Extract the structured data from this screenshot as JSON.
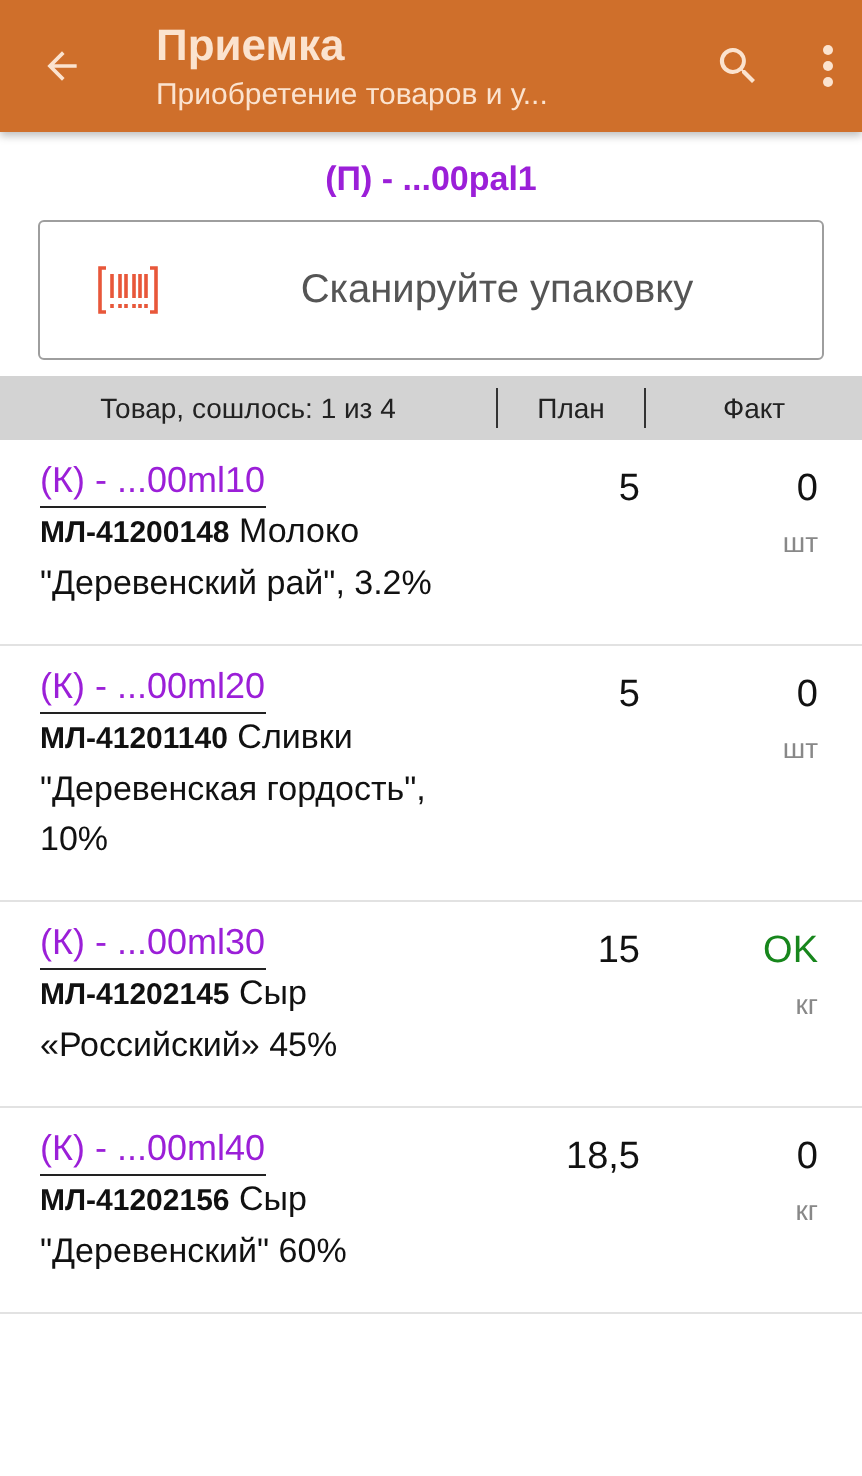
{
  "app_bar": {
    "title": "Приемка",
    "subtitle": "Приобретение товаров и у..."
  },
  "pallet": "(П) - ...00pal1",
  "scan_field": {
    "placeholder": "Сканируйте упаковку"
  },
  "table": {
    "columns": [
      "Товар, сошлось: 1 из 4",
      "План",
      "Факт"
    ],
    "rows": [
      {
        "package": "(К) - ...00ml10",
        "description": "**МЛ-41200148** Молоко \"Деревенский рай\", 3.2%",
        "plan": "5",
        "fact": "0",
        "unit": "шт",
        "matched": false
      },
      {
        "package": "(К) - ...00ml20",
        "description": "**МЛ-41201140** Сливки \"Деревенская гордость\", 10%",
        "plan": "5",
        "fact": "0",
        "unit": "шт",
        "matched": false
      },
      {
        "package": "(К) - ...00ml30",
        "description": "**МЛ-41202145** Сыр «Российский» 45%",
        "plan": "15",
        "fact": "OK",
        "unit": "кг",
        "matched": true
      },
      {
        "package": "(К) - ...00ml40",
        "description": "**МЛ-41202156** Сыр \"Деревенский\" 60%",
        "plan": "18,5",
        "fact": "0",
        "unit": "кг",
        "matched": false
      }
    ]
  }
}
